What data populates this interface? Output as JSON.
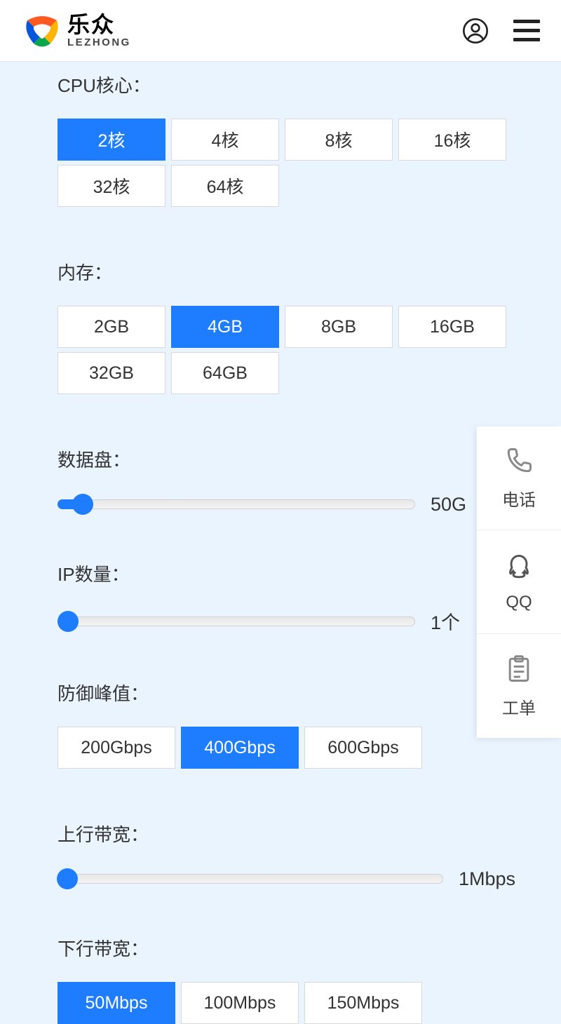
{
  "header": {
    "brand_cn": "乐众",
    "brand_en": "LEZHONG"
  },
  "config": {
    "cpu": {
      "label": "CPU核心：",
      "options": [
        "2核",
        "4核",
        "8核",
        "16核",
        "32核",
        "64核"
      ],
      "selected": 0
    },
    "memory": {
      "label": "内存：",
      "options": [
        "2GB",
        "4GB",
        "8GB",
        "16GB",
        "32GB",
        "64GB"
      ],
      "selected": 1
    },
    "disk": {
      "label": "数据盘：",
      "value_text": "50G",
      "thumb_pct": 7,
      "fill_pct": 7
    },
    "ip": {
      "label": "IP数量：",
      "value_text": "1个",
      "thumb_pct": 0,
      "fill_pct": 0
    },
    "defense": {
      "label": "防御峰值：",
      "options": [
        "200Gbps",
        "400Gbps",
        "600Gbps"
      ],
      "selected": 1
    },
    "up": {
      "label": "上行带宽：",
      "value_text": "1Mbps",
      "thumb_pct": 0,
      "fill_pct": 0
    },
    "down": {
      "label": "下行带宽：",
      "options": [
        "50Mbps",
        "100Mbps",
        "150Mbps"
      ],
      "selected": 0
    }
  },
  "float": {
    "phone": "电话",
    "qq": "QQ",
    "ticket": "工单"
  }
}
